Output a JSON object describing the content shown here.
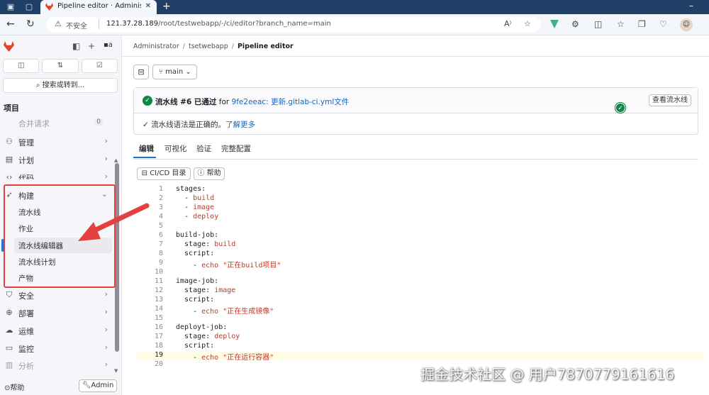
{
  "browser": {
    "tab_title": "Pipeline editor · Administrator / t",
    "insecure_label": "不安全",
    "url_host": "121.37.28.189",
    "url_path": "/root/testwebapp/-/ci/editor?branch_name=main"
  },
  "sidebar": {
    "avatar_alt": "a",
    "search_label": "搜索或转到...",
    "section_title": "项目",
    "merge_requests": {
      "label": "合并请求",
      "count": "0"
    },
    "items": [
      {
        "label": "管理",
        "icon": "users-icon"
      },
      {
        "label": "计划",
        "icon": "plan-icon"
      },
      {
        "label": "代码",
        "icon": "code-icon"
      },
      {
        "label": "构建",
        "icon": "rocket-icon"
      }
    ],
    "build_sub": [
      {
        "label": "流水线"
      },
      {
        "label": "作业"
      },
      {
        "label": "流水线编辑器"
      },
      {
        "label": "流水线计划"
      },
      {
        "label": "产物"
      }
    ],
    "items_after": [
      {
        "label": "安全",
        "icon": "shield-icon"
      },
      {
        "label": "部署",
        "icon": "deploy-icon"
      },
      {
        "label": "运维",
        "icon": "operate-icon"
      },
      {
        "label": "监控",
        "icon": "monitor-icon"
      },
      {
        "label": "分析",
        "icon": "chart-icon"
      }
    ],
    "help_label": "帮助",
    "admin_label": "Admin"
  },
  "breadcrumb": {
    "items": [
      "Administrator",
      "tsetwebapp",
      "Pipeline editor"
    ]
  },
  "branch": "main",
  "status": {
    "prefix": "流水线 #6 已通过",
    "for": "for",
    "commit": "9fe2eeac: 更新.gitlab-ci.yml文件",
    "view_button": "查看流水线",
    "lint_text": "流水线语法是正确的。",
    "learn_more": "了解更多"
  },
  "tabs": [
    "编辑",
    "可视化",
    "验证",
    "完整配置"
  ],
  "toolbar": {
    "cicd": "CI/CD 目录",
    "help": "帮助"
  },
  "editor_lines": [
    {
      "n": "1",
      "t": "stages:"
    },
    {
      "n": "2",
      "t": "  - build"
    },
    {
      "n": "3",
      "t": "  - image"
    },
    {
      "n": "4",
      "t": "  - deploy"
    },
    {
      "n": "5",
      "t": ""
    },
    {
      "n": "6",
      "t": "build-job:"
    },
    {
      "n": "7",
      "t": "  stage: build"
    },
    {
      "n": "8",
      "t": "  script:"
    },
    {
      "n": "9",
      "t": "    - echo \"正在build项目\""
    },
    {
      "n": "10",
      "t": ""
    },
    {
      "n": "11",
      "t": "image-job:"
    },
    {
      "n": "12",
      "t": "  stage: image"
    },
    {
      "n": "13",
      "t": "  script:"
    },
    {
      "n": "14",
      "t": "    - echo \"正在生成镜像\""
    },
    {
      "n": "15",
      "t": ""
    },
    {
      "n": "16",
      "t": "deployt-job:"
    },
    {
      "n": "17",
      "t": "  stage: deploy"
    },
    {
      "n": "18",
      "t": "  script:"
    },
    {
      "n": "19",
      "t": "    - echo \"正在运行容器\""
    },
    {
      "n": "20",
      "t": ""
    }
  ],
  "current_line": "19",
  "watermark": "掘金技术社区 @ 用户7870779161616",
  "colors": {
    "accent": "#1f75cb",
    "success": "#108548",
    "annotation": "#e3403f"
  }
}
